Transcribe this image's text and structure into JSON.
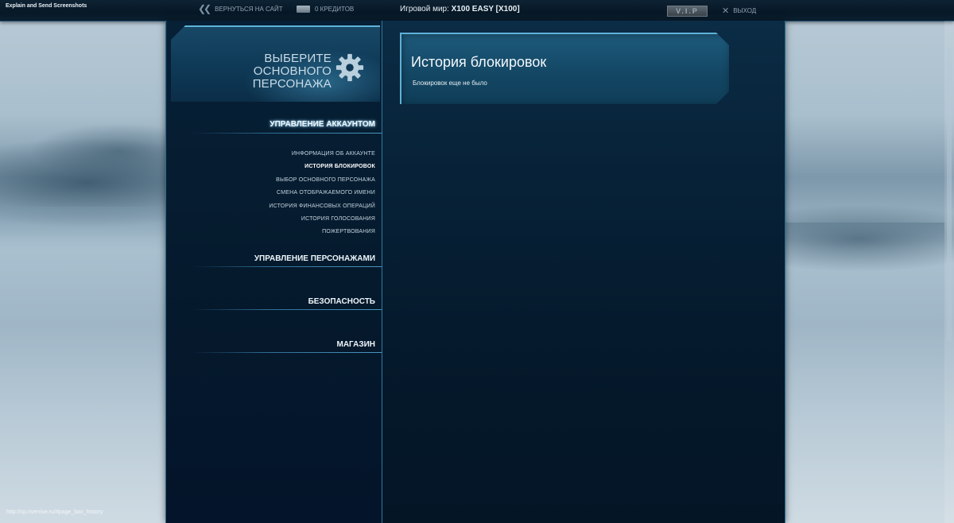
{
  "topbar": {
    "extension": "Explain and Send Screenshots",
    "back_link": "ВЕРНУТЬСЯ НА САЙТ",
    "credits_link": "0 КРЕДИТОВ",
    "world_label": "Игровой мир:",
    "world_value": "X100 EASY [X100]",
    "vip": "V.I.P",
    "logout": "ВЫХОД"
  },
  "sidebar": {
    "header_title_line1": "ВЫБЕРИТЕ ОСНОВНОГО",
    "header_title_line2": "ПЕРСОНАЖА",
    "sections": [
      {
        "title": "УПРАВЛЕНИЕ АККАУНТОМ"
      },
      {
        "title": "УПРАВЛЕНИЕ ПЕРСОНАЖАМИ"
      },
      {
        "title": "БЕЗОПАСНОСТЬ"
      },
      {
        "title": "МАГАЗИН"
      }
    ],
    "account_items": [
      {
        "label": "ИНФОРМАЦИЯ ОБ АККАУНТЕ"
      },
      {
        "label": "ИСТОРИЯ БЛОКИРОВОК",
        "active": true
      },
      {
        "label": "ВЫБОР ОСНОВНОГО ПЕРСОНАЖА"
      },
      {
        "label": "СМЕНА ОТОБРАЖАЕМОГО ИМЕНИ"
      },
      {
        "label": "ИСТОРИЯ ФИНАНСОВЫХ ОПЕРАЦИЙ"
      },
      {
        "label": "ИСТОРИЯ ГОЛОСОВАНИЯ"
      },
      {
        "label": "ПОЖЕРТВОВАНИЯ"
      }
    ]
  },
  "content": {
    "title": "История блокировок",
    "text": "Блокировок еще не было"
  },
  "status_bar": {
    "url": "http://cp.riverrise.ru/#page_ban_history"
  },
  "colors": {
    "accent": "#5fb1d8",
    "panel": "#134764",
    "frame": "#051a2d"
  }
}
